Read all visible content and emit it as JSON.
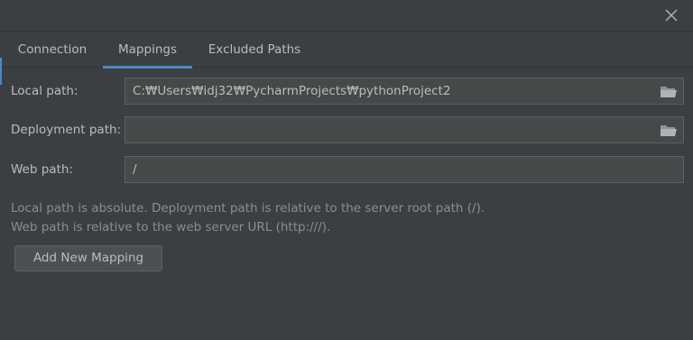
{
  "tabs": [
    {
      "label": "Connection",
      "active": false
    },
    {
      "label": "Mappings",
      "active": true
    },
    {
      "label": "Excluded Paths",
      "active": false
    }
  ],
  "fields": {
    "local_path": {
      "label": "Local path:",
      "value": "C:₩Users₩idj32₩PycharmProjects₩pythonProject2"
    },
    "deployment_path": {
      "label": "Deployment path:",
      "value": ""
    },
    "web_path": {
      "label": "Web path:",
      "value": "/"
    }
  },
  "info": {
    "line1": "Local path is absolute. Deployment path is relative to the server root path (/).",
    "line2": "Web path is relative to the web server URL (http:///)."
  },
  "buttons": {
    "add_mapping": "Add New Mapping"
  },
  "icons": {
    "close": "close-icon",
    "folder": "folder-icon"
  },
  "colors": {
    "background": "#3c3f41",
    "accent": "#4a88c7",
    "field_bg": "#45494a"
  }
}
